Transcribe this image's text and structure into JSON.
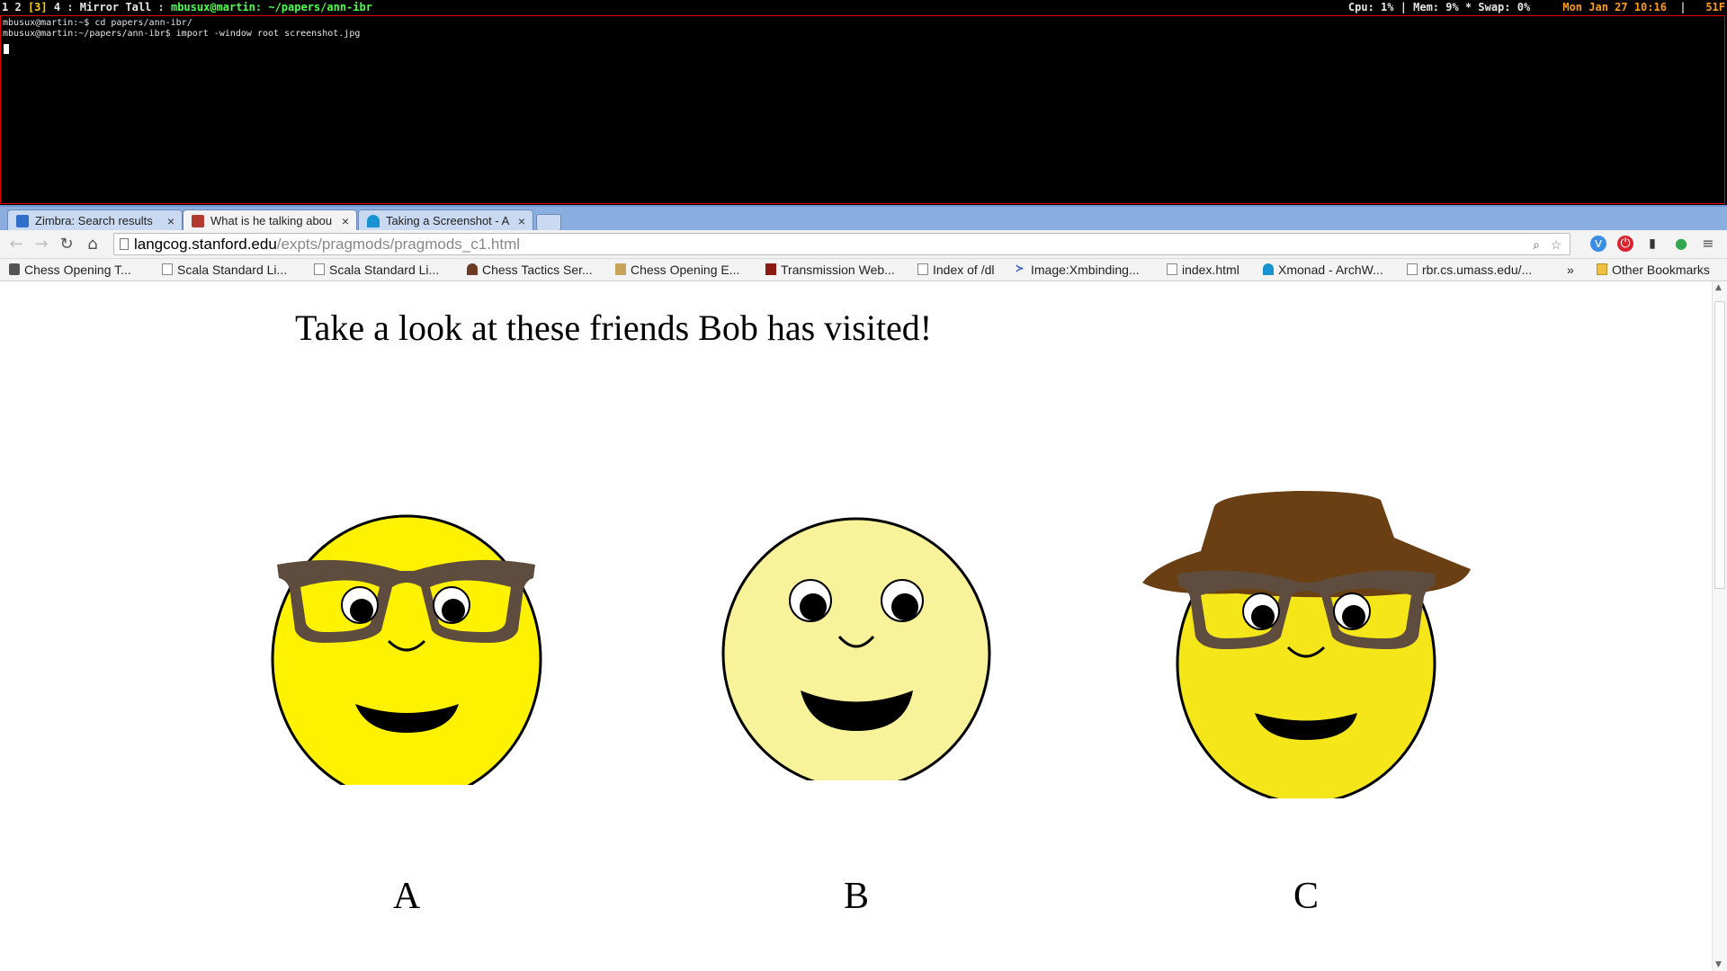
{
  "statusbar": {
    "workspaces": [
      "1",
      "2",
      "[3]",
      "4"
    ],
    "layout": "Mirror Tall",
    "window_title": "mbusux@martin: ~/papers/ann-ibr",
    "system": "Cpu: 1% | Mem: 9% * Swap: 0%",
    "datetime": "Mon Jan 27 10:16",
    "temp": "51F"
  },
  "terminal": {
    "lines": [
      "mbusux@martin:~$ cd papers/ann-ibr/",
      "mbusux@martin:~/papers/ann-ibr$ import -window root screenshot.jpg"
    ]
  },
  "browser": {
    "tabs": [
      {
        "label": "Zimbra: Search results",
        "icon": "zimbra-icon",
        "color": "#2f6fc9"
      },
      {
        "label": "What is he talking abou",
        "icon": "puzzle-icon",
        "color": "#b33a2f"
      },
      {
        "label": "Taking a Screenshot - A",
        "icon": "arch-icon",
        "color": "#1793d1"
      }
    ],
    "url_host": "langcog.stanford.edu",
    "url_path": "/expts/pragmods/pragmods_c1.html",
    "bookmarks": [
      {
        "label": "Chess Opening T...",
        "icon": "chess-icon"
      },
      {
        "label": "Scala Standard Li...",
        "icon": "page-icon"
      },
      {
        "label": "Scala Standard Li...",
        "icon": "page-icon"
      },
      {
        "label": "Chess Tactics Ser...",
        "icon": "knight-icon"
      },
      {
        "label": "Chess Opening E...",
        "icon": "chess-icon"
      },
      {
        "label": "Transmission Web...",
        "icon": "transmission-icon"
      },
      {
        "label": "Index of /dl",
        "icon": "page-icon"
      },
      {
        "label": "Image:Xmbinding...",
        "icon": "xmonad-icon"
      },
      {
        "label": "index.html",
        "icon": "page-icon"
      },
      {
        "label": "Xmonad - ArchW...",
        "icon": "arch-icon"
      },
      {
        "label": "rbr.cs.umass.edu/...",
        "icon": "page-icon"
      }
    ],
    "overflow": "»",
    "other_bookmarks": "Other Bookmarks"
  },
  "page": {
    "heading": "Take a look at these friends Bob has visited!",
    "choices": [
      {
        "label": "A",
        "face_color": "#fff200",
        "glasses": true,
        "hat": false
      },
      {
        "label": "B",
        "face_color": "#f8f29a",
        "glasses": false,
        "hat": false
      },
      {
        "label": "C",
        "face_color": "#f5e61a",
        "glasses": true,
        "hat": true
      }
    ],
    "colors": {
      "glasses": "#5e4d3f",
      "hat": "#6b3f14",
      "outline": "#000000"
    }
  }
}
